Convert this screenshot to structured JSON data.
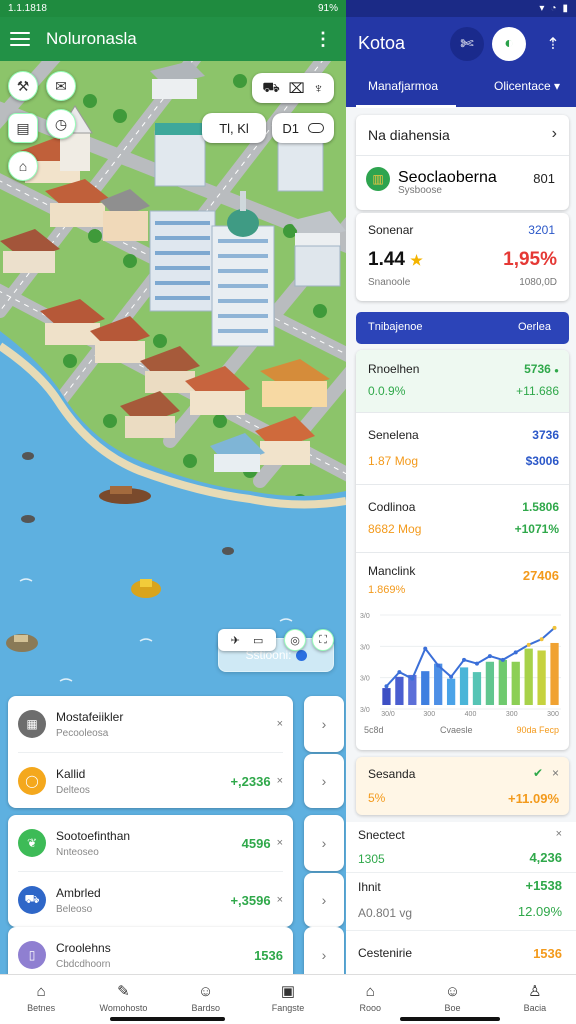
{
  "left": {
    "status": {
      "time": "1.1.1818",
      "right": "91%"
    },
    "app_title": "Noluronasla",
    "map_chips": {
      "chip_a": "Tl, Kl",
      "chip_b": "D1"
    },
    "map_search_label": "Sstiooni:",
    "rows": [
      {
        "title": "Mostafeiikler",
        "sub": "Pecooleosa",
        "value": "",
        "icon": "building-icon",
        "color": "#6d6d6d"
      },
      {
        "title": "Kallid",
        "sub": "Delteos",
        "value": "+,2336",
        "icon": "shield-icon",
        "color": "#f4a81d"
      },
      {
        "title": "Sootoefinthan",
        "sub": "Nnteoseo",
        "value": "4596",
        "icon": "leaf-icon",
        "color": "#3dbb57"
      },
      {
        "title": "Ambrled",
        "sub": "Beleoso",
        "value": "+,3596",
        "icon": "car-icon",
        "color": "#2f67c8"
      },
      {
        "title": "Croolehns",
        "sub": "Cbdcdhoorn",
        "value": "1536",
        "icon": "phone-icon",
        "color": "#8f7fd1"
      }
    ]
  },
  "right": {
    "app_title": "Kotoa",
    "tabs": [
      "Manafjarmoa",
      "Olicentace"
    ],
    "header_card": {
      "title": "Na diahensia"
    },
    "item": {
      "title": "Seoclaoberna",
      "sub": "Sysboose",
      "value": "801"
    },
    "stat1": {
      "label": "Sonenar",
      "badge": "3201",
      "big": "1.44",
      "pct": "1,95%",
      "foot_l": "Snanoole",
      "foot_r": "1080,0D"
    },
    "section": {
      "left": "Tnibajenoe",
      "right": "Oerlea"
    },
    "metrics": [
      {
        "label": "Rnoelhen",
        "val1": "5736",
        "val2": "0.0.9%",
        "val3": "+11.686"
      },
      {
        "label": "Senelena",
        "val1": "3736",
        "val2": "1.87 Mog",
        "val3": "$3006"
      },
      {
        "label": "Codlinoa",
        "val1": "1.5806",
        "val2": "8682 Mog",
        "val3": "+1071%"
      },
      {
        "label": "Manclink",
        "val1": "27406",
        "val2": "1.869%",
        "val3": ""
      }
    ],
    "alert": {
      "title": "Sesanda",
      "pct": "5%",
      "value": "+11.09%"
    },
    "list": [
      {
        "label": "Snectect",
        "a": "",
        "b": ""
      },
      {
        "label": "",
        "a": "1305",
        "b": "4,236"
      },
      {
        "label": "Ihnit",
        "a": "",
        "b": "+1538"
      },
      {
        "label": "",
        "a": "A0.801 vg",
        "b": "12.09%"
      },
      {
        "label": "Cestenirie",
        "a": "",
        "b": "1536"
      }
    ],
    "chart_labels": {
      "foot_l": "5c8d",
      "foot_m": "Cvaesle",
      "foot_r": "90da Fecp"
    }
  },
  "chart_data": {
    "type": "bar",
    "categories": [
      "1",
      "2",
      "3",
      "4",
      "5",
      "6",
      "7",
      "8",
      "9",
      "10",
      "11",
      "12",
      "13",
      "14"
    ],
    "values": [
      18,
      30,
      32,
      36,
      44,
      28,
      40,
      35,
      46,
      48,
      46,
      60,
      58,
      66
    ],
    "line": [
      20,
      35,
      28,
      60,
      42,
      30,
      48,
      44,
      52,
      48,
      56,
      64,
      70,
      82
    ],
    "yticks": [
      "3/0",
      "3/0",
      "3/0",
      "3/0"
    ],
    "xticks": [
      "30/0",
      "300",
      "400",
      "300",
      "300"
    ],
    "ylim": [
      0,
      100
    ]
  },
  "bottom_nav": [
    {
      "label": "Betnes",
      "icon": "home-icon"
    },
    {
      "label": "Womohosto",
      "icon": "edit-icon"
    },
    {
      "label": "Bardso",
      "icon": "person-icon"
    },
    {
      "label": "Fangste",
      "icon": "image-icon"
    },
    {
      "label": "Rooo",
      "icon": "bag-icon"
    },
    {
      "label": "Boe",
      "icon": "smile-icon"
    },
    {
      "label": "Bacia",
      "icon": "profile-icon"
    }
  ]
}
